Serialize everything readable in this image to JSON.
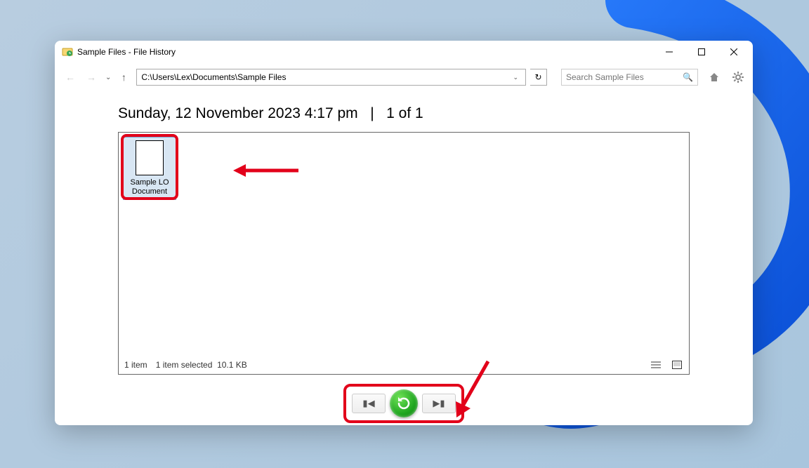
{
  "window": {
    "title": "Sample Files - File History"
  },
  "toolbar": {
    "path": "C:\\Users\\Lex\\Documents\\Sample Files",
    "search_placeholder": "Search Sample Files"
  },
  "headline": {
    "timestamp": "Sunday, 12 November 2023 4:17 pm",
    "separator": "|",
    "counter": "1 of 1"
  },
  "files": [
    {
      "name": "Sample LO Document"
    }
  ],
  "status": {
    "item_count": "1 item",
    "selection": "1 item selected",
    "size": "10.1 KB"
  },
  "annotations": {
    "highlight_color": "#e2001a"
  }
}
